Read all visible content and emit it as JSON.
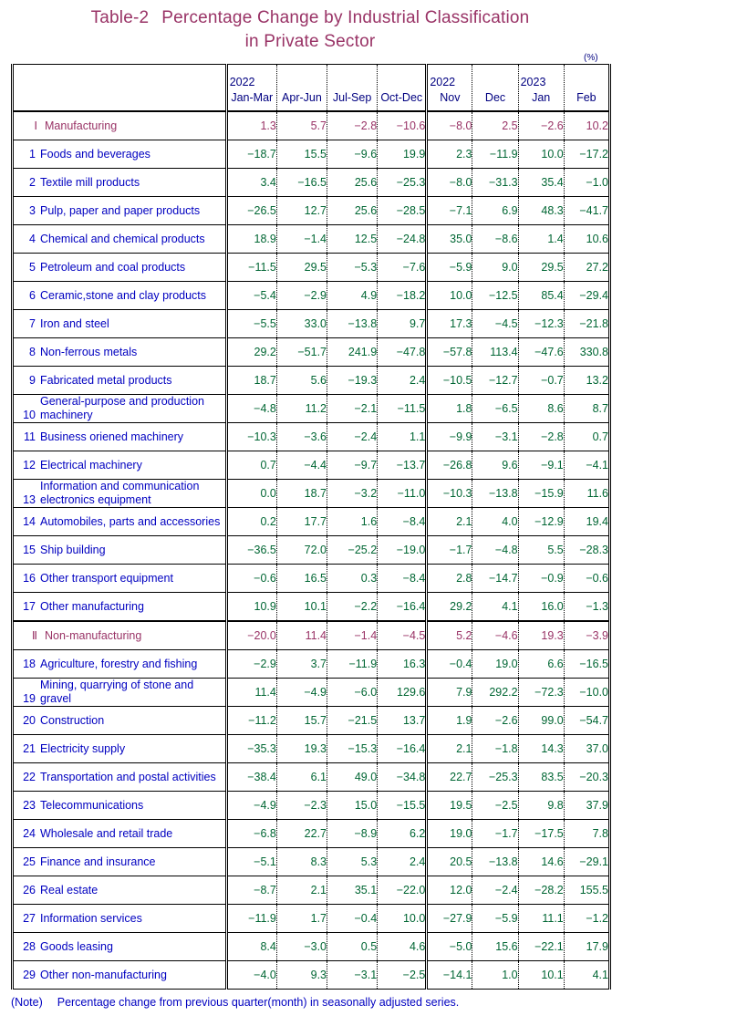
{
  "title": {
    "line1_number": "Table-2",
    "line1_text": "Percentage Change by Industrial Classification",
    "line2_text": "in Private Sector"
  },
  "unit_marker": "(%)",
  "header": {
    "label_column": "",
    "columns": [
      {
        "year": "2022",
        "period": "Jan-Mar"
      },
      {
        "year": "",
        "period": "Apr-Jun"
      },
      {
        "year": "",
        "period": "Jul-Sep"
      },
      {
        "year": "",
        "period": "Oct-Dec"
      },
      {
        "year": "2022",
        "period": "Nov"
      },
      {
        "year": "",
        "period": "Dec"
      },
      {
        "year": "2023",
        "period": "Jan"
      },
      {
        "year": "",
        "period": "Feb"
      }
    ]
  },
  "colors": {
    "title": "#993366",
    "section": "#993366",
    "label": "#0000c0",
    "value": "#006633",
    "header_text": "#000080",
    "border": "#000000"
  },
  "rows": [
    {
      "num": "Ⅰ",
      "label": "Manufacturing",
      "section": true,
      "wrapped": false,
      "values": [
        "1.3",
        "5.7",
        "−2.8",
        "−10.6",
        "−8.0",
        "2.5",
        "−2.6",
        "10.2"
      ]
    },
    {
      "num": "1",
      "label": "Foods and beverages",
      "section": false,
      "wrapped": false,
      "values": [
        "−18.7",
        "15.5",
        "−9.6",
        "19.9",
        "2.3",
        "−11.9",
        "10.0",
        "−17.2"
      ]
    },
    {
      "num": "2",
      "label": "Textile mill products",
      "section": false,
      "wrapped": false,
      "values": [
        "3.4",
        "−16.5",
        "25.6",
        "−25.3",
        "−8.0",
        "−31.3",
        "35.4",
        "−1.0"
      ]
    },
    {
      "num": "3",
      "label": "Pulp, paper and paper products",
      "section": false,
      "wrapped": false,
      "values": [
        "−26.5",
        "12.7",
        "25.6",
        "−28.5",
        "−7.1",
        "6.9",
        "48.3",
        "−41.7"
      ]
    },
    {
      "num": "4",
      "label": "Chemical and chemical products",
      "section": false,
      "wrapped": false,
      "values": [
        "18.9",
        "−1.4",
        "12.5",
        "−24.8",
        "35.0",
        "−8.6",
        "1.4",
        "10.6"
      ]
    },
    {
      "num": "5",
      "label": "Petroleum and coal products",
      "section": false,
      "wrapped": false,
      "values": [
        "−11.5",
        "29.5",
        "−5.3",
        "−7.6",
        "−5.9",
        "9.0",
        "29.5",
        "27.2"
      ]
    },
    {
      "num": "6",
      "label": "Ceramic,stone and clay products",
      "section": false,
      "wrapped": false,
      "values": [
        "−5.4",
        "−2.9",
        "4.9",
        "−18.2",
        "10.0",
        "−12.5",
        "85.4",
        "−29.4"
      ]
    },
    {
      "num": "7",
      "label": "Iron and steel",
      "section": false,
      "wrapped": false,
      "values": [
        "−5.5",
        "33.0",
        "−13.8",
        "9.7",
        "17.3",
        "−4.5",
        "−12.3",
        "−21.8"
      ]
    },
    {
      "num": "8",
      "label": "Non-ferrous metals",
      "section": false,
      "wrapped": false,
      "values": [
        "29.2",
        "−51.7",
        "241.9",
        "−47.8",
        "−57.8",
        "113.4",
        "−47.6",
        "330.8"
      ]
    },
    {
      "num": "9",
      "label": "Fabricated metal products",
      "section": false,
      "wrapped": false,
      "values": [
        "18.7",
        "5.6",
        "−19.3",
        "2.4",
        "−10.5",
        "−12.7",
        "−0.7",
        "13.2"
      ]
    },
    {
      "num": "10",
      "label": "General-purpose and production machinery",
      "section": false,
      "wrapped": true,
      "values": [
        "−4.8",
        "11.2",
        "−2.1",
        "−11.5",
        "1.8",
        "−6.5",
        "8.6",
        "8.7"
      ]
    },
    {
      "num": "11",
      "label": "Business oriened machinery",
      "section": false,
      "wrapped": false,
      "values": [
        "−10.3",
        "−3.6",
        "−2.4",
        "1.1",
        "−9.9",
        "−3.1",
        "−2.8",
        "0.7"
      ]
    },
    {
      "num": "12",
      "label": "Electrical machinery",
      "section": false,
      "wrapped": false,
      "values": [
        "0.7",
        "−4.4",
        "−9.7",
        "−13.7",
        "−26.8",
        "9.6",
        "−9.1",
        "−4.1"
      ]
    },
    {
      "num": "13",
      "label": "Information and communication electronics equipment",
      "section": false,
      "wrapped": true,
      "values": [
        "0.0",
        "18.7",
        "−3.2",
        "−11.0",
        "−10.3",
        "−13.8",
        "−15.9",
        "11.6"
      ]
    },
    {
      "num": "14",
      "label": "Automobiles, parts and accessories",
      "section": false,
      "wrapped": true,
      "values": [
        "0.2",
        "17.7",
        "1.6",
        "−8.4",
        "2.1",
        "4.0",
        "−12.9",
        "19.4"
      ]
    },
    {
      "num": "15",
      "label": "Ship building",
      "section": false,
      "wrapped": false,
      "values": [
        "−36.5",
        "72.0",
        "−25.2",
        "−19.0",
        "−1.7",
        "−4.8",
        "5.5",
        "−28.3"
      ]
    },
    {
      "num": "16",
      "label": "Other transport equipment",
      "section": false,
      "wrapped": false,
      "values": [
        "−0.6",
        "16.5",
        "0.3",
        "−8.4",
        "2.8",
        "−14.7",
        "−0.9",
        "−0.6"
      ]
    },
    {
      "num": "17",
      "label": "Other manufacturing",
      "section": false,
      "wrapped": false,
      "values": [
        "10.9",
        "10.1",
        "−2.2",
        "−16.4",
        "29.2",
        "4.1",
        "16.0",
        "−1.3"
      ]
    },
    {
      "num": "Ⅱ",
      "label": "Non-manufacturing",
      "section": true,
      "wrapped": false,
      "values": [
        "−20.0",
        "11.4",
        "−1.4",
        "−4.5",
        "5.2",
        "−4.6",
        "19.3",
        "−3.9"
      ]
    },
    {
      "num": "18",
      "label": "Agriculture, forestry and fishing",
      "section": false,
      "wrapped": false,
      "values": [
        "−2.9",
        "3.7",
        "−11.9",
        "16.3",
        "−0.4",
        "19.0",
        "6.6",
        "−16.5"
      ]
    },
    {
      "num": "19",
      "label": "Mining, quarrying of stone and gravel",
      "section": false,
      "wrapped": true,
      "values": [
        "11.4",
        "−4.9",
        "−6.0",
        "129.6",
        "7.9",
        "292.2",
        "−72.3",
        "−10.0"
      ]
    },
    {
      "num": "20",
      "label": "Construction",
      "section": false,
      "wrapped": false,
      "values": [
        "−11.2",
        "15.7",
        "−21.5",
        "13.7",
        "1.9",
        "−2.6",
        "99.0",
        "−54.7"
      ]
    },
    {
      "num": "21",
      "label": "Electricity supply",
      "section": false,
      "wrapped": false,
      "values": [
        "−35.3",
        "19.3",
        "−15.3",
        "−16.4",
        "2.1",
        "−1.8",
        "14.3",
        "37.0"
      ]
    },
    {
      "num": "22",
      "label": "Transportation and postal activities",
      "section": false,
      "wrapped": false,
      "values": [
        "−38.4",
        "6.1",
        "49.0",
        "−34.8",
        "22.7",
        "−25.3",
        "83.5",
        "−20.3"
      ]
    },
    {
      "num": "23",
      "label": "Telecommunications",
      "section": false,
      "wrapped": false,
      "values": [
        "−4.9",
        "−2.3",
        "15.0",
        "−15.5",
        "19.5",
        "−2.5",
        "9.8",
        "37.9"
      ]
    },
    {
      "num": "24",
      "label": "Wholesale and retail trade",
      "section": false,
      "wrapped": false,
      "values": [
        "−6.8",
        "22.7",
        "−8.9",
        "6.2",
        "19.0",
        "−1.7",
        "−17.5",
        "7.8"
      ]
    },
    {
      "num": "25",
      "label": "Finance and insurance",
      "section": false,
      "wrapped": false,
      "values": [
        "−5.1",
        "8.3",
        "5.3",
        "2.4",
        "20.5",
        "−13.8",
        "14.6",
        "−29.1"
      ]
    },
    {
      "num": "26",
      "label": "Real estate",
      "section": false,
      "wrapped": false,
      "values": [
        "−8.7",
        "2.1",
        "35.1",
        "−22.0",
        "12.0",
        "−2.4",
        "−28.2",
        "155.5"
      ]
    },
    {
      "num": "27",
      "label": "Information services",
      "section": false,
      "wrapped": false,
      "values": [
        "−11.9",
        "1.7",
        "−0.4",
        "10.0",
        "−27.9",
        "−5.9",
        "11.1",
        "−1.2"
      ]
    },
    {
      "num": "28",
      "label": "Goods leasing",
      "section": false,
      "wrapped": false,
      "values": [
        "8.4",
        "−3.0",
        "0.5",
        "4.6",
        "−5.0",
        "15.6",
        "−22.1",
        "17.9"
      ]
    },
    {
      "num": "29",
      "label": "Other non-manufacturing",
      "section": false,
      "wrapped": false,
      "values": [
        "−4.0",
        "9.3",
        "−3.1",
        "−2.5",
        "−14.1",
        "1.0",
        "10.1",
        "4.1"
      ]
    }
  ],
  "note": {
    "label": "(Note)",
    "text": "Percentage change from previous quarter(month) in seasonally adjusted series."
  },
  "chart_data": {
    "type": "table",
    "title": "Table-2 Percentage Change by Industrial Classification in Private Sector",
    "unit": "%",
    "categories": [
      "2022 Jan-Mar",
      "2022 Apr-Jun",
      "2022 Jul-Sep",
      "2022 Oct-Dec",
      "2022 Nov",
      "2022 Dec",
      "2023 Jan",
      "2023 Feb"
    ],
    "series": [
      {
        "name": "Ⅰ Manufacturing",
        "values": [
          1.3,
          5.7,
          -2.8,
          -10.6,
          -8.0,
          2.5,
          -2.6,
          10.2
        ]
      },
      {
        "name": "1 Foods and beverages",
        "values": [
          -18.7,
          15.5,
          -9.6,
          19.9,
          2.3,
          -11.9,
          10.0,
          -17.2
        ]
      },
      {
        "name": "2 Textile mill products",
        "values": [
          3.4,
          -16.5,
          25.6,
          -25.3,
          -8.0,
          -31.3,
          35.4,
          -1.0
        ]
      },
      {
        "name": "3 Pulp, paper and paper products",
        "values": [
          -26.5,
          12.7,
          25.6,
          -28.5,
          -7.1,
          6.9,
          48.3,
          -41.7
        ]
      },
      {
        "name": "4 Chemical and chemical products",
        "values": [
          18.9,
          -1.4,
          12.5,
          -24.8,
          35.0,
          -8.6,
          1.4,
          10.6
        ]
      },
      {
        "name": "5 Petroleum and coal products",
        "values": [
          -11.5,
          29.5,
          -5.3,
          -7.6,
          -5.9,
          9.0,
          29.5,
          27.2
        ]
      },
      {
        "name": "6 Ceramic,stone and clay products",
        "values": [
          -5.4,
          -2.9,
          4.9,
          -18.2,
          10.0,
          -12.5,
          85.4,
          -29.4
        ]
      },
      {
        "name": "7 Iron and steel",
        "values": [
          -5.5,
          33.0,
          -13.8,
          9.7,
          17.3,
          -4.5,
          -12.3,
          -21.8
        ]
      },
      {
        "name": "8 Non-ferrous metals",
        "values": [
          29.2,
          -51.7,
          241.9,
          -47.8,
          -57.8,
          113.4,
          -47.6,
          330.8
        ]
      },
      {
        "name": "9 Fabricated metal products",
        "values": [
          18.7,
          5.6,
          -19.3,
          2.4,
          -10.5,
          -12.7,
          -0.7,
          13.2
        ]
      },
      {
        "name": "10 General-purpose and production machinery",
        "values": [
          -4.8,
          11.2,
          -2.1,
          -11.5,
          1.8,
          -6.5,
          8.6,
          8.7
        ]
      },
      {
        "name": "11 Business oriened machinery",
        "values": [
          -10.3,
          -3.6,
          -2.4,
          1.1,
          -9.9,
          -3.1,
          -2.8,
          0.7
        ]
      },
      {
        "name": "12 Electrical machinery",
        "values": [
          0.7,
          -4.4,
          -9.7,
          -13.7,
          -26.8,
          9.6,
          -9.1,
          -4.1
        ]
      },
      {
        "name": "13 Information and communication electronics equipment",
        "values": [
          0.0,
          18.7,
          -3.2,
          -11.0,
          -10.3,
          -13.8,
          -15.9,
          11.6
        ]
      },
      {
        "name": "14 Automobiles, parts and accessories",
        "values": [
          0.2,
          17.7,
          1.6,
          -8.4,
          2.1,
          4.0,
          -12.9,
          19.4
        ]
      },
      {
        "name": "15 Ship building",
        "values": [
          -36.5,
          72.0,
          -25.2,
          -19.0,
          -1.7,
          -4.8,
          5.5,
          -28.3
        ]
      },
      {
        "name": "16 Other transport equipment",
        "values": [
          -0.6,
          16.5,
          0.3,
          -8.4,
          2.8,
          -14.7,
          -0.9,
          -0.6
        ]
      },
      {
        "name": "17 Other manufacturing",
        "values": [
          10.9,
          10.1,
          -2.2,
          -16.4,
          29.2,
          4.1,
          16.0,
          -1.3
        ]
      },
      {
        "name": "Ⅱ Non-manufacturing",
        "values": [
          -20.0,
          11.4,
          -1.4,
          -4.5,
          5.2,
          -4.6,
          19.3,
          -3.9
        ]
      },
      {
        "name": "18 Agriculture, forestry and fishing",
        "values": [
          -2.9,
          3.7,
          -11.9,
          16.3,
          -0.4,
          19.0,
          6.6,
          -16.5
        ]
      },
      {
        "name": "19 Mining, quarrying of stone and gravel",
        "values": [
          11.4,
          -4.9,
          -6.0,
          129.6,
          7.9,
          292.2,
          -72.3,
          -10.0
        ]
      },
      {
        "name": "20 Construction",
        "values": [
          -11.2,
          15.7,
          -21.5,
          13.7,
          1.9,
          -2.6,
          99.0,
          -54.7
        ]
      },
      {
        "name": "21 Electricity supply",
        "values": [
          -35.3,
          19.3,
          -15.3,
          -16.4,
          2.1,
          -1.8,
          14.3,
          37.0
        ]
      },
      {
        "name": "22 Transportation and postal activities",
        "values": [
          -38.4,
          6.1,
          49.0,
          -34.8,
          22.7,
          -25.3,
          83.5,
          -20.3
        ]
      },
      {
        "name": "23 Telecommunications",
        "values": [
          -4.9,
          -2.3,
          15.0,
          -15.5,
          19.5,
          -2.5,
          9.8,
          37.9
        ]
      },
      {
        "name": "24 Wholesale and retail trade",
        "values": [
          -6.8,
          22.7,
          -8.9,
          6.2,
          19.0,
          -1.7,
          -17.5,
          7.8
        ]
      },
      {
        "name": "25 Finance and insurance",
        "values": [
          -5.1,
          8.3,
          5.3,
          2.4,
          20.5,
          -13.8,
          14.6,
          -29.1
        ]
      },
      {
        "name": "26 Real estate",
        "values": [
          -8.7,
          2.1,
          35.1,
          -22.0,
          12.0,
          -2.4,
          -28.2,
          155.5
        ]
      },
      {
        "name": "27 Information services",
        "values": [
          -11.9,
          1.7,
          -0.4,
          10.0,
          -27.9,
          -5.9,
          11.1,
          -1.2
        ]
      },
      {
        "name": "28 Goods leasing",
        "values": [
          8.4,
          -3.0,
          0.5,
          4.6,
          -5.0,
          15.6,
          -22.1,
          17.9
        ]
      },
      {
        "name": "29 Other non-manufacturing",
        "values": [
          -4.0,
          9.3,
          -3.1,
          -2.5,
          -14.1,
          1.0,
          10.1,
          4.1
        ]
      }
    ]
  }
}
